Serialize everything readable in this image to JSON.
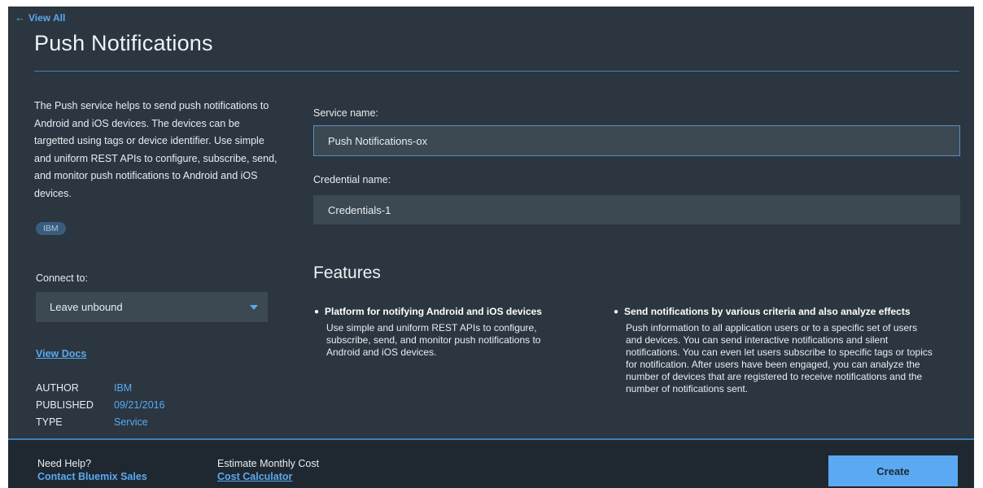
{
  "nav": {
    "back_label": "View All",
    "back_arrow": "←"
  },
  "page": {
    "title": "Push Notifications"
  },
  "sidebar": {
    "description": "The Push service helps to send push notifications to Android and iOS devices. The devices can be targetted using tags or device identifier. Use simple and uniform REST APIs to configure, subscribe, send, and monitor push notifications to Android and iOS devices.",
    "tag": "IBM",
    "connect_label": "Connect to:",
    "connect_value": "Leave unbound",
    "view_docs": "View Docs",
    "meta": [
      {
        "key": "AUTHOR",
        "value": "IBM"
      },
      {
        "key": "PUBLISHED",
        "value": "09/21/2016"
      },
      {
        "key": "TYPE",
        "value": "Service"
      }
    ]
  },
  "form": {
    "service_label": "Service name:",
    "service_value": "Push Notifications-ox",
    "credential_label": "Credential name:",
    "credential_value": "Credentials-1"
  },
  "features": {
    "heading": "Features",
    "items": [
      {
        "title": "Platform for notifying Android and iOS devices",
        "description": "Use simple and uniform REST APIs to configure, subscribe, send, and monitor push notifications to Android and iOS devices."
      },
      {
        "title": "Send notifications by various criteria and also analyze effects",
        "description": "Push information to all application users or to a specific set of users and devices. You can send interactive notifications and silent notifications. You can even let users subscribe to specific tags or topics for notification. After users have been engaged, you can analyze the number of devices that are registered to receive notifications and the number of notifications sent."
      }
    ]
  },
  "footer": {
    "help_label": "Need Help?",
    "help_link": "Contact Bluemix Sales",
    "cost_label": "Estimate Monthly Cost",
    "cost_link": "Cost Calculator",
    "create_label": "Create"
  },
  "colors": {
    "background": "#2b3640",
    "accent": "#5aa9f2",
    "footer": "#1f2831"
  }
}
